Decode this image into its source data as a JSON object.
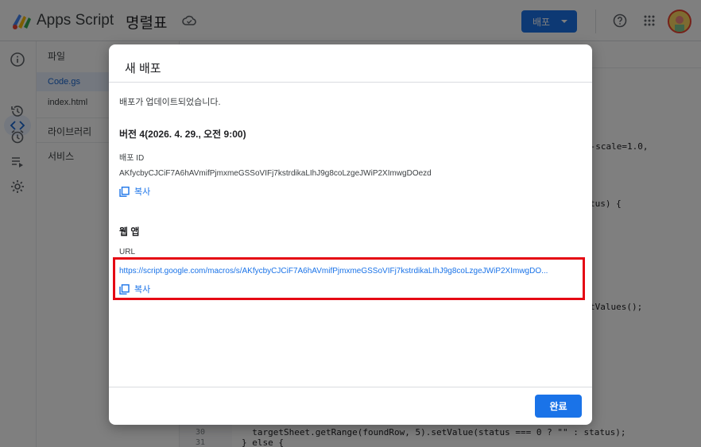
{
  "header": {
    "app_name": "Apps Script",
    "project_name": "명렬표",
    "deploy_label": "배포",
    "icons": [
      "apps-script-logo",
      "cloud-icon",
      "chevron-down-icon",
      "help-icon",
      "apps-grid-icon",
      "avatar"
    ]
  },
  "rail": {
    "icons": [
      "info-icon",
      "code-icon",
      "history-icon",
      "alarm-icon",
      "executions-icon",
      "settings-icon"
    ]
  },
  "files": {
    "section_files": "파일",
    "items": [
      {
        "name": "Code.gs",
        "active": true
      },
      {
        "name": "index.html",
        "active": false
      }
    ],
    "section_libraries": "라이브러리",
    "section_services": "서비스"
  },
  "editor": {
    "fragments": [
      "m-scale=1.0,",
      "tus) {",
      "tValues();"
    ],
    "lines": [
      {
        "no": "30",
        "text": "  targetSheet.getRange(foundRow, 5).setValue(status === 0 ? \"\" : status);"
      },
      {
        "no": "31",
        "text": "} else {"
      }
    ]
  },
  "dialog": {
    "title": "새 배포",
    "updated_msg": "배포가 업데이트되었습니다.",
    "version": "버전 4(2026. 4. 29., 오전 9:00)",
    "deploy_id_label": "배포 ID",
    "deploy_id": "AKfycbyCJCiF7A6hAVmifPjmxmeGSSoVIFj7kstrdikaLIhJ9g8coLzgeJWiP2XImwgDOezd",
    "copy_label": "복사",
    "webapp_label": "웹 앱",
    "url_label": "URL",
    "url": "https://script.google.com/macros/s/AKfycbyCJCiF7A6hAVmifPjmxmeGSSoVIFj7kstrdikaLIhJ9g8coLzgeJWiP2XImwgDO...",
    "done_label": "완료"
  },
  "colors": {
    "accent": "#1a73e8",
    "highlight": "#e50914"
  }
}
